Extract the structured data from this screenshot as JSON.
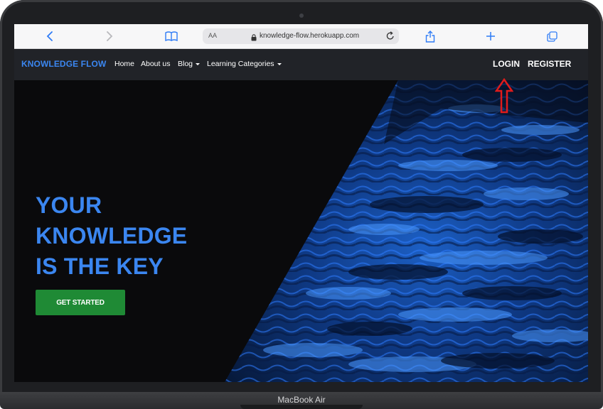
{
  "device": {
    "label": "MacBook Air"
  },
  "browser": {
    "url": "knowledge-flow.herokuapp.com",
    "text_size_label": "AA"
  },
  "navbar": {
    "brand": "KNOWLEDGE FLOW",
    "items": [
      {
        "label": "Home"
      },
      {
        "label": "About us"
      },
      {
        "label": "Blog"
      },
      {
        "label": "Learning Categories"
      }
    ],
    "login": "LOGIN",
    "register": "REGISTER"
  },
  "hero": {
    "line1": "YOUR",
    "line2": "KNOWLEDGE",
    "line3": "IS THE KEY",
    "cta": "GET STARTED"
  },
  "colors": {
    "brand_blue": "#3b86f0",
    "cta_green": "#1f8a35",
    "navbar_bg": "#212328",
    "annotation_red": "#e01b1b"
  }
}
